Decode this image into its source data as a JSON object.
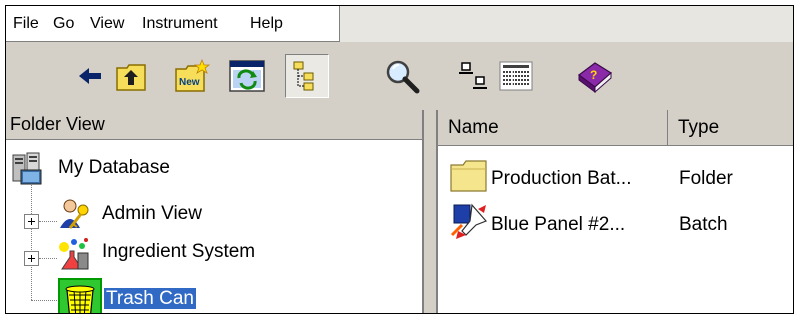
{
  "menu": {
    "items": [
      "File",
      "Go",
      "View",
      "Instrument",
      "Help"
    ]
  },
  "toolbar": {
    "buttons": [
      {
        "icon": "back-arrow-icon"
      },
      {
        "icon": "up-folder-icon"
      },
      {
        "icon": "new-folder-icon",
        "label": "New"
      },
      {
        "icon": "refresh-window-icon"
      },
      {
        "icon": "tree-view-icon",
        "pressed": true
      },
      {
        "icon": "search-magnifier-icon"
      },
      {
        "icon": "large-icons-view-icon"
      },
      {
        "icon": "details-view-icon"
      },
      {
        "icon": "help-book-icon"
      }
    ]
  },
  "folder_view": {
    "title": "Folder View",
    "root": "My Database",
    "items": [
      {
        "label": "Admin View",
        "expandable": true
      },
      {
        "label": "Ingredient System",
        "expandable": true
      },
      {
        "label": "Trash Can",
        "expandable": false,
        "selected": true
      }
    ]
  },
  "list_view": {
    "columns": [
      "Name",
      "Type"
    ],
    "rows": [
      {
        "name": "Production Bat...",
        "type": "Folder",
        "icon": "folder-icon"
      },
      {
        "name": "Blue Panel #2...",
        "type": "Batch",
        "icon": "batch-rocket-icon"
      }
    ]
  },
  "colors": {
    "chrome": "#d4d0c8",
    "selection": "#316ac5",
    "folder": "#f5e58c"
  }
}
